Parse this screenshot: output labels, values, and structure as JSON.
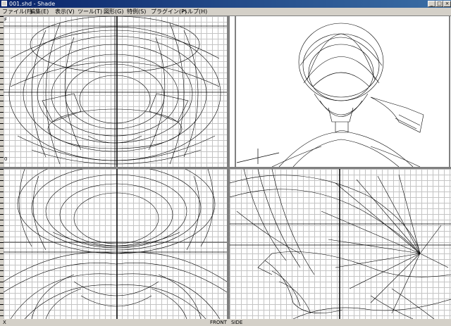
{
  "window": {
    "title": "001.shd - Shade",
    "min_glyph": "_",
    "max_glyph": "□",
    "close_glyph": "×"
  },
  "menu": {
    "items": [
      "ファイル(F)",
      "編集(E)",
      "表示(V)",
      "ツール(T)",
      "図形(G)",
      "特例(S)",
      "プラグイン(P)",
      "ヘルプ(H)"
    ]
  },
  "viewports": {
    "top": {
      "corner_label": "F",
      "side_label": "0"
    },
    "bottom_left_label": "X",
    "status": {
      "front": "FRONT",
      "side": "SIDE"
    }
  },
  "colors": {
    "wire": "#000000",
    "grid": "#c4c4c4",
    "chrome": "#d4d0c8",
    "title_start": "#0a246a",
    "title_end": "#3a6ea5"
  },
  "icons": {
    "app": "shade-app-icon",
    "minimize": "minimize-icon",
    "maximize": "maximize-icon",
    "close": "close-icon"
  }
}
